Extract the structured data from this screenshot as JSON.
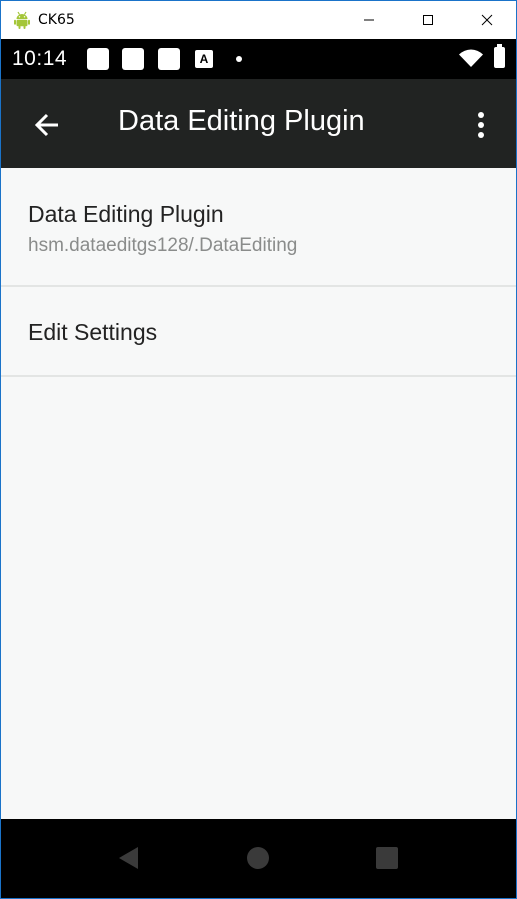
{
  "window": {
    "title": "CK65",
    "app_icon": "android-icon",
    "controls": [
      "minimize-icon",
      "maximize-icon",
      "close-icon"
    ]
  },
  "status_bar": {
    "time": "10:14",
    "notification_icons": [
      "notification-icon",
      "notification-icon",
      "notification-icon",
      "a-notification-icon",
      "dot-icon"
    ],
    "a_icon_label": "A",
    "system_icons": [
      "wifi-icon",
      "battery-icon"
    ]
  },
  "app_bar": {
    "title": "Data Editing Plugin",
    "back_icon": "arrow-back-icon",
    "menu_icon": "more-vert-icon",
    "background": "#212322"
  },
  "preferences": [
    {
      "title": "Data Editing Plugin",
      "summary": "hsm.dataeditgs128/.DataEditing"
    },
    {
      "title": "Edit Settings"
    }
  ],
  "nav_bar": {
    "buttons": [
      "back-triangle-icon",
      "home-circle-icon",
      "recents-square-icon"
    ]
  },
  "colors": {
    "window_border": "#1a73c9",
    "content_background": "#f7f8f8",
    "android_green": "#a4c639"
  }
}
